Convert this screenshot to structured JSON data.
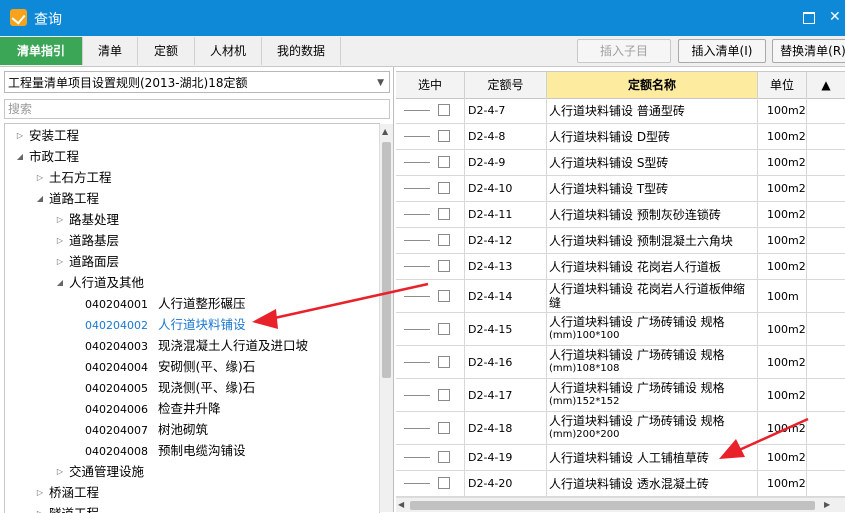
{
  "window": {
    "title": "查询"
  },
  "tabs": [
    "清单指引",
    "清单",
    "定额",
    "人材机",
    "我的数据"
  ],
  "toolbar": {
    "insert_child": "插入子目",
    "insert_list": "插入清单(I)",
    "replace_list": "替换清单(R)"
  },
  "left": {
    "rule_select": "工程量清单项目设置规则(2013-湖北)18定额",
    "search_placeholder": "搜索",
    "tree": [
      {
        "label": "安装工程",
        "level": 0,
        "state": "collapsed"
      },
      {
        "label": "市政工程",
        "level": 0,
        "state": "expanded"
      },
      {
        "label": "土石方工程",
        "level": 1,
        "state": "collapsed"
      },
      {
        "label": "道路工程",
        "level": 1,
        "state": "expanded"
      },
      {
        "label": "路基处理",
        "level": 2,
        "state": "collapsed"
      },
      {
        "label": "道路基层",
        "level": 2,
        "state": "collapsed"
      },
      {
        "label": "道路面层",
        "level": 2,
        "state": "collapsed"
      },
      {
        "label": "人行道及其他",
        "level": 2,
        "state": "expanded"
      },
      {
        "code": "040204001",
        "label": "人行道整形碾压",
        "level": 3
      },
      {
        "code": "040204002",
        "label": "人行道块料铺设",
        "level": 3,
        "selected": true
      },
      {
        "code": "040204003",
        "label": "现浇混凝土人行道及进口坡",
        "level": 3
      },
      {
        "code": "040204004",
        "label": "安砌侧(平、缘)石",
        "level": 3
      },
      {
        "code": "040204005",
        "label": "现浇侧(平、缘)石",
        "level": 3
      },
      {
        "code": "040204006",
        "label": "检查井升降",
        "level": 3
      },
      {
        "code": "040204007",
        "label": "树池砌筑",
        "level": 3
      },
      {
        "code": "040204008",
        "label": "预制电缆沟铺设",
        "level": 3
      },
      {
        "label": "交通管理设施",
        "level": 2,
        "state": "collapsed"
      },
      {
        "label": "桥涵工程",
        "level": 1,
        "state": "collapsed"
      },
      {
        "label": "隧道工程",
        "level": 1,
        "state": "collapsed"
      }
    ]
  },
  "grid": {
    "headers": [
      "选中",
      "定额号",
      "定额名称",
      "单位"
    ],
    "rows": [
      {
        "code": "D2-4-7",
        "name": "人行道块料铺设 普通型砖",
        "unit": "100m2"
      },
      {
        "code": "D2-4-8",
        "name": "人行道块料铺设 D型砖",
        "unit": "100m2"
      },
      {
        "code": "D2-4-9",
        "name": "人行道块料铺设 S型砖",
        "unit": "100m2"
      },
      {
        "code": "D2-4-10",
        "name": "人行道块料铺设 T型砖",
        "unit": "100m2"
      },
      {
        "code": "D2-4-11",
        "name": "人行道块料铺设 预制灰砂连锁砖",
        "unit": "100m2"
      },
      {
        "code": "D2-4-12",
        "name": "人行道块料铺设 预制混凝土六角块",
        "unit": "100m2"
      },
      {
        "code": "D2-4-13",
        "name": "人行道块料铺设 花岗岩人行道板",
        "unit": "100m2"
      },
      {
        "code": "D2-4-14",
        "name": "人行道块料铺设 花岗岩人行道板伸缩",
        "name2": "缝",
        "unit": "100m"
      },
      {
        "code": "D2-4-15",
        "name": "人行道块料铺设 广场砖铺设 规格",
        "name2": "(mm)100*100",
        "unit": "100m2"
      },
      {
        "code": "D2-4-16",
        "name": "人行道块料铺设 广场砖铺设 规格",
        "name2": "(mm)108*108",
        "unit": "100m2"
      },
      {
        "code": "D2-4-17",
        "name": "人行道块料铺设 广场砖铺设 规格",
        "name2": "(mm)152*152",
        "unit": "100m2"
      },
      {
        "code": "D2-4-18",
        "name": "人行道块料铺设 广场砖铺设 规格",
        "name2": "(mm)200*200",
        "unit": "100m2"
      },
      {
        "code": "D2-4-19",
        "name": "人行道块料铺设 人工铺植草砖",
        "unit": "100m2"
      },
      {
        "code": "D2-4-20",
        "name": "人行道块料铺设 透水混凝土砖",
        "unit": "100m2"
      }
    ]
  },
  "colors": {
    "titlebar": "#0e89d8",
    "active_tab": "#3aa656",
    "active_header": "#fdeca0",
    "selected_text": "#1b78d0",
    "annotation": "#e8212b"
  }
}
